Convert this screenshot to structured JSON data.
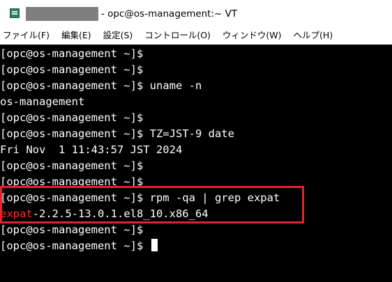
{
  "window": {
    "title": "- opc@os-management:~ VT"
  },
  "menu": [
    {
      "label": "ファイル(F)"
    },
    {
      "label": "編集(E)"
    },
    {
      "label": "設定(S)"
    },
    {
      "label": "コントロール(O)"
    },
    {
      "label": "ウィンドウ(W)"
    },
    {
      "label": "ヘルプ(H)"
    }
  ],
  "terminal": {
    "lines": [
      "[opc@os-management ~]$",
      "[opc@os-management ~]$",
      "[opc@os-management ~]$ uname -n",
      "os-management",
      "[opc@os-management ~]$",
      "[opc@os-management ~]$ TZ=JST-9 date",
      "Fri Nov  1 11:43:57 JST 2024",
      "[opc@os-management ~]$",
      "[opc@os-management ~]$",
      "[opc@os-management ~]$ rpm -qa | grep expat"
    ],
    "match_line": {
      "highlight": "expat",
      "rest": "-2.2.5-13.0.1.el8_10.x86_64"
    },
    "after_lines": [
      "[opc@os-management ~]$",
      "[opc@os-management ~]$ "
    ],
    "highlight_color": "#e2242d",
    "match_color": "#ff2a2a"
  }
}
